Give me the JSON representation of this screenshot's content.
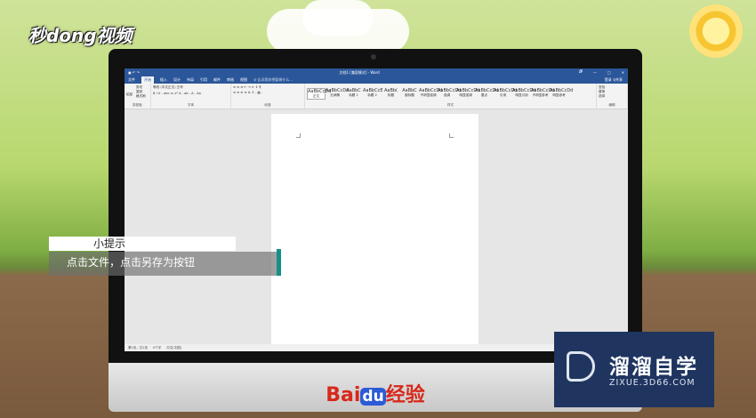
{
  "brand": {
    "logo": "秒dong视频",
    "watermark_name": "溜溜自学",
    "watermark_url": "ZIXUE.3D66.COM",
    "baidu_logo": "Bai",
    "baidu_du": "du",
    "baidu_suffix": "经验"
  },
  "word": {
    "title": "文档1 [兼容模式] - Word",
    "window_controls": [
      "🗗",
      "—",
      "□",
      "✕"
    ],
    "tabs": [
      "文件",
      "开始",
      "插入",
      "设计",
      "布局",
      "引用",
      "邮件",
      "审阅",
      "视图"
    ],
    "tell_me": "♀ 告诉我你想要做什么...",
    "share": "登录  ♀共享",
    "clipboard": {
      "paste": "粘贴",
      "cut": "剪切",
      "copy": "复制",
      "painter": "格式刷",
      "label": "剪贴板"
    },
    "font": {
      "name": "等线 (中文正文)",
      "size": "五号",
      "row2": "B I U - abc x₂ x²  A - ab - A - Aa",
      "label": "字体"
    },
    "paragraph": {
      "row1": "≡ ≡ ≡  ⇤ ⇥  ✕ ↕ ¶",
      "row2": "≡ ≡ ≡ ≡ ≣  ↕ -  ▦ -",
      "label": "段落"
    },
    "styles": [
      {
        "sample": "AaBbCcDd",
        "name": "正文"
      },
      {
        "sample": "AaBbCcDd",
        "name": "无间隔"
      },
      {
        "sample": "AaBbC",
        "name": "标题 1"
      },
      {
        "sample": "AaBbCcE",
        "name": "标题 2"
      },
      {
        "sample": "AaBb(",
        "name": "标题"
      },
      {
        "sample": "AaBbC",
        "name": "副标题"
      },
      {
        "sample": "AaBbCcDd",
        "name": "不明显强调"
      },
      {
        "sample": "AaBbCcDd",
        "name": "强调"
      },
      {
        "sample": "AaBbCcDd",
        "name": "明显强调"
      },
      {
        "sample": "AaBbCcDd",
        "name": "要点"
      },
      {
        "sample": "AaBbCcDd",
        "name": "引用"
      },
      {
        "sample": "AaBbCcDd",
        "name": "明显引用"
      },
      {
        "sample": "AaBbCcDd",
        "name": "不明显参考"
      },
      {
        "sample": "AaBbCcDd",
        "name": "明显参考"
      }
    ],
    "styles_label": "样式",
    "editing": {
      "find": "查找",
      "replace": "替换",
      "select": "选择",
      "label": "编辑"
    },
    "status": {
      "page": "第1页，共1页",
      "words": "0个字",
      "lang": "中文(中国)"
    }
  },
  "tip": {
    "title": "小提示",
    "body": "点击文件，点击另存为按钮"
  },
  "colors": {
    "word_blue": "#2b579a",
    "tip_accent": "#14908a",
    "watermark_bg": "#1f3560",
    "baidu_red": "#d8281b"
  }
}
